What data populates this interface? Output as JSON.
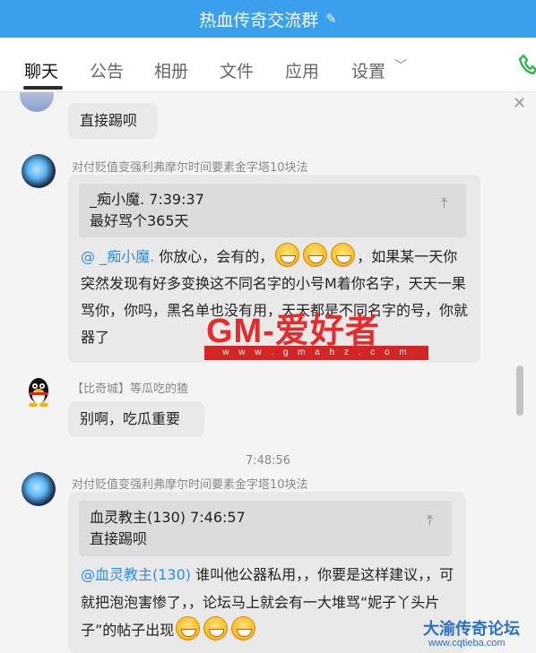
{
  "titlebar": {
    "title": "热血传奇交流群",
    "edit_icon": "pencil-icon"
  },
  "tabs": [
    {
      "label": "聊天",
      "active": true
    },
    {
      "label": "公告"
    },
    {
      "label": "相册"
    },
    {
      "label": "文件"
    },
    {
      "label": "应用"
    },
    {
      "label": "设置"
    }
  ],
  "messages": {
    "m1": {
      "text": "直接踢呗"
    },
    "m2": {
      "sender": "对付贬值变强利弗摩尔时间要素金字塔10块法",
      "quote_name_time": "_痴小魔.   7:39:37",
      "quote_text": "最好骂个365天",
      "mention": "@ _痴小魔.",
      "part1": " 你放心，会有的，",
      "part2": "，如果某一天你突然发现有好多变换这不同名字的小号M着你名字，天天一果骂你，你吗，黑名单也没有用，天天都是不同名字的号，你就器了"
    },
    "m3": {
      "sender": "【比奇城】等瓜吃的猹",
      "text": "别啊，吃瓜重要"
    },
    "timestamp": "7:48:56",
    "m4": {
      "sender": "对付贬值变强利弗摩尔时间要素金字塔10块法",
      "quote_name_time": "血灵教主(130)   7:46:57",
      "quote_text": "直接踢呗",
      "mention": "@血灵教主(130)",
      "part1": " 谁叫他公器私用，，你要是这样建议，，可就把泡泡害惨了，，论坛马上就会有一大堆骂“妮子丫头片子”的帖子出现"
    }
  },
  "watermark": {
    "logo": "GM-爱好者",
    "url": "w w w . g m a h z . c o m"
  },
  "forum_mark": {
    "title": "大渝传奇论坛",
    "url": "www.cqtieba.com"
  },
  "colors": {
    "titlebar": "#3aa0ee",
    "mention": "#2d8fdc",
    "bubble": "#e9e9e9"
  }
}
